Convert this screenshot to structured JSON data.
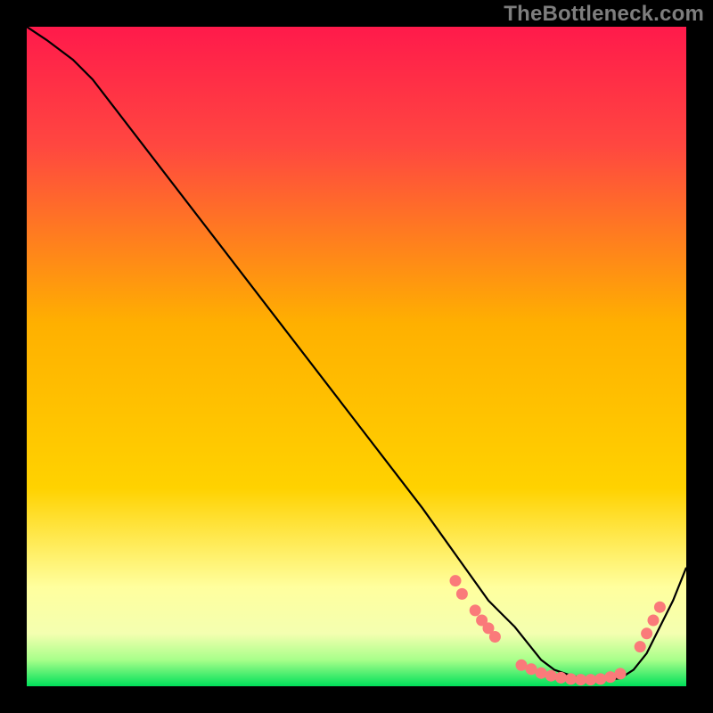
{
  "watermark": "TheBottleneck.com",
  "colors": {
    "page_bg": "#000000",
    "watermark": "#7e7e7e",
    "line": "#000000",
    "dots": "#fa7a7a",
    "grad_top": "#ff1a4b",
    "grad_mid": "#ffd200",
    "grad_pale": "#ffff9e",
    "grad_bottom": "#00e05a"
  },
  "chart_data": {
    "type": "line",
    "title": "",
    "xlabel": "",
    "ylabel": "",
    "xlim": [
      0,
      100
    ],
    "ylim": [
      0,
      100
    ],
    "grid": false,
    "legend": false,
    "series": [
      {
        "name": "curve",
        "x": [
          0,
          3,
          7,
          10,
          20,
          30,
          40,
          50,
          60,
          65,
          70,
          72,
          74,
          76,
          78,
          80,
          82,
          84,
          86,
          88,
          90,
          92,
          94,
          96,
          98,
          100
        ],
        "y": [
          100,
          98,
          95,
          92,
          79,
          66,
          53,
          40,
          27,
          20,
          13,
          11,
          9,
          6.5,
          4,
          2.5,
          1.8,
          1.2,
          1,
          1,
          1.2,
          2.5,
          5,
          9,
          13,
          18
        ]
      }
    ],
    "dot_clusters": [
      {
        "name": "left-slope-dots",
        "points": [
          {
            "x": 65,
            "y": 16
          },
          {
            "x": 66,
            "y": 14
          },
          {
            "x": 68,
            "y": 11.5
          },
          {
            "x": 69,
            "y": 10
          },
          {
            "x": 70,
            "y": 8.8
          },
          {
            "x": 71,
            "y": 7.5
          }
        ]
      },
      {
        "name": "valley-dots",
        "points": [
          {
            "x": 75,
            "y": 3.2
          },
          {
            "x": 76.5,
            "y": 2.6
          },
          {
            "x": 78,
            "y": 2.0
          },
          {
            "x": 79.5,
            "y": 1.6
          },
          {
            "x": 81,
            "y": 1.3
          },
          {
            "x": 82.5,
            "y": 1.1
          },
          {
            "x": 84,
            "y": 1.0
          },
          {
            "x": 85.5,
            "y": 1.0
          },
          {
            "x": 87,
            "y": 1.1
          },
          {
            "x": 88.5,
            "y": 1.4
          },
          {
            "x": 90,
            "y": 1.9
          }
        ]
      },
      {
        "name": "right-slope-dots",
        "points": [
          {
            "x": 93,
            "y": 6
          },
          {
            "x": 94,
            "y": 8
          },
          {
            "x": 95,
            "y": 10
          },
          {
            "x": 96,
            "y": 12
          }
        ]
      }
    ]
  }
}
